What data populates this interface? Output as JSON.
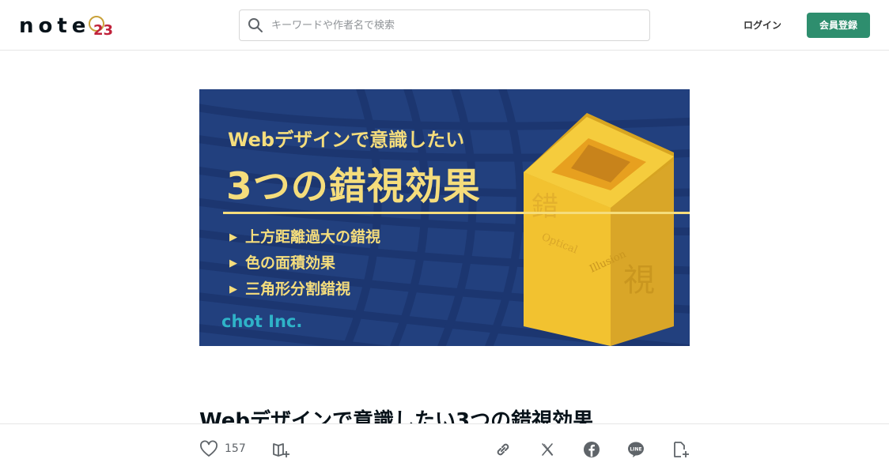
{
  "header": {
    "logo_text": "note",
    "logo_badge": "23",
    "search": {
      "placeholder": "キーワードや作者名で検索",
      "value": ""
    },
    "login_label": "ログイン",
    "signup_label": "会員登録"
  },
  "banner": {
    "subtitle": "Webデザインで意識したい",
    "title": "3つの錯視効果",
    "bullets": [
      "上方距離過大の錯視",
      "色の面積効果",
      "三角形分割錯視"
    ],
    "brand": "chot Inc.",
    "cube_text": {
      "kanji_top": "錯",
      "kanji_bottom": "視",
      "word1": "Optical",
      "word2": "Illusion"
    },
    "colors": {
      "background": "#22407e",
      "accent": "#f5dd7c",
      "brand": "#2fb3c8",
      "cube": "#f2c230"
    }
  },
  "article": {
    "title": "Webデザインで意識したい3つの錯視効果"
  },
  "action_bar": {
    "like_count": "157",
    "icons": [
      "heart-icon",
      "magazine-add-icon",
      "link-icon",
      "x-icon",
      "facebook-icon",
      "line-icon",
      "embed-icon"
    ]
  },
  "colors": {
    "signup_button": "#2e8e6e",
    "border": "#e6e6e6",
    "text": "#08131a"
  }
}
